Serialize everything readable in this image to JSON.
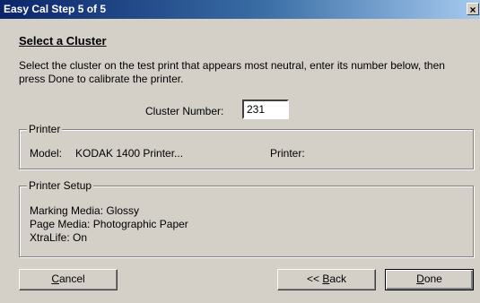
{
  "window": {
    "title": "Easy Cal Step 5 of 5",
    "close_glyph": "×"
  },
  "heading": {
    "prefix": "S",
    "rest": "elect a Cluster"
  },
  "instructions": "Select the cluster on the test print that appears most neutral, enter its number below, then press Done to calibrate the printer.",
  "cluster": {
    "label": "Cluster Number:",
    "value": "231"
  },
  "printer_group": {
    "legend": "Printer",
    "model_label": "Model:",
    "model_value": "KODAK 1400 Printer...",
    "printer_label": "Printer:"
  },
  "setup_group": {
    "legend": "Printer Setup",
    "marking_media": "Marking Media: Glossy",
    "page_media": "Page Media: Photographic Paper",
    "xtralife": "XtraLife: On"
  },
  "buttons": {
    "cancel": {
      "mnemonic": "C",
      "rest": "ancel"
    },
    "back": {
      "prefix": "<< ",
      "mnemonic": "B",
      "rest": "ack"
    },
    "done": {
      "mnemonic": "D",
      "rest": "one"
    }
  }
}
